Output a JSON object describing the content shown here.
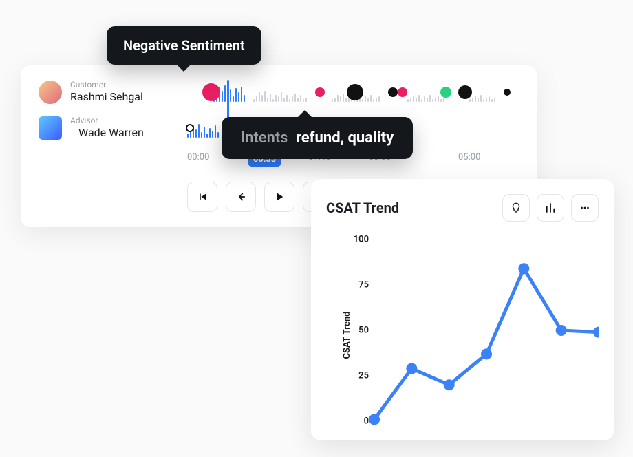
{
  "call": {
    "customer": {
      "role": "Customer",
      "name": "Rashmi Sehgal"
    },
    "advisor": {
      "role": "Advisor",
      "name": "Wade Warren"
    },
    "timestamps": [
      "00:00",
      "00:33",
      "01:45",
      "03:30",
      "05:00"
    ],
    "tooltips": {
      "sentiment": "Negative Sentiment",
      "intents_label": "Intents",
      "intents_value": "refund, quality"
    }
  },
  "chart_card": {
    "title": "CSAT Trend"
  },
  "chart_data": {
    "type": "line",
    "title": "CSAT Trend",
    "ylabel": "CSAT Trend",
    "xlabel": "",
    "ylim": [
      0,
      100
    ],
    "y_ticks": [
      0,
      25,
      50,
      75,
      100
    ],
    "x": [
      1,
      2,
      3,
      4,
      5,
      6,
      7
    ],
    "series": [
      {
        "name": "CSAT Trend",
        "values": [
          1,
          29,
          20,
          37,
          84,
          50,
          49
        ]
      }
    ]
  }
}
